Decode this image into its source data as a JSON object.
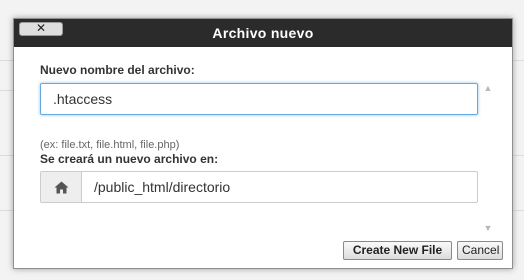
{
  "dialog": {
    "title": "Archivo nuevo",
    "close_label": "✕",
    "filename_label": "Nuevo nombre del archivo:",
    "filename_value": ".htaccess",
    "filename_hint": "(ex: file.txt, file.html, file.php)",
    "location_label": "Se creará un nuevo archivo en:",
    "location_value": "/public_html/directorio",
    "home_icon": "home-icon",
    "scroll_up_icon": "scroll-up-icon",
    "scroll_down_icon": "scroll-down-icon"
  },
  "footer": {
    "create_label": "Create New File",
    "cancel_label": "Cancel"
  },
  "colors": {
    "titlebar": "#2b2b2b",
    "focus_border": "#66a9e0",
    "addon_bg": "#eeeeee"
  }
}
